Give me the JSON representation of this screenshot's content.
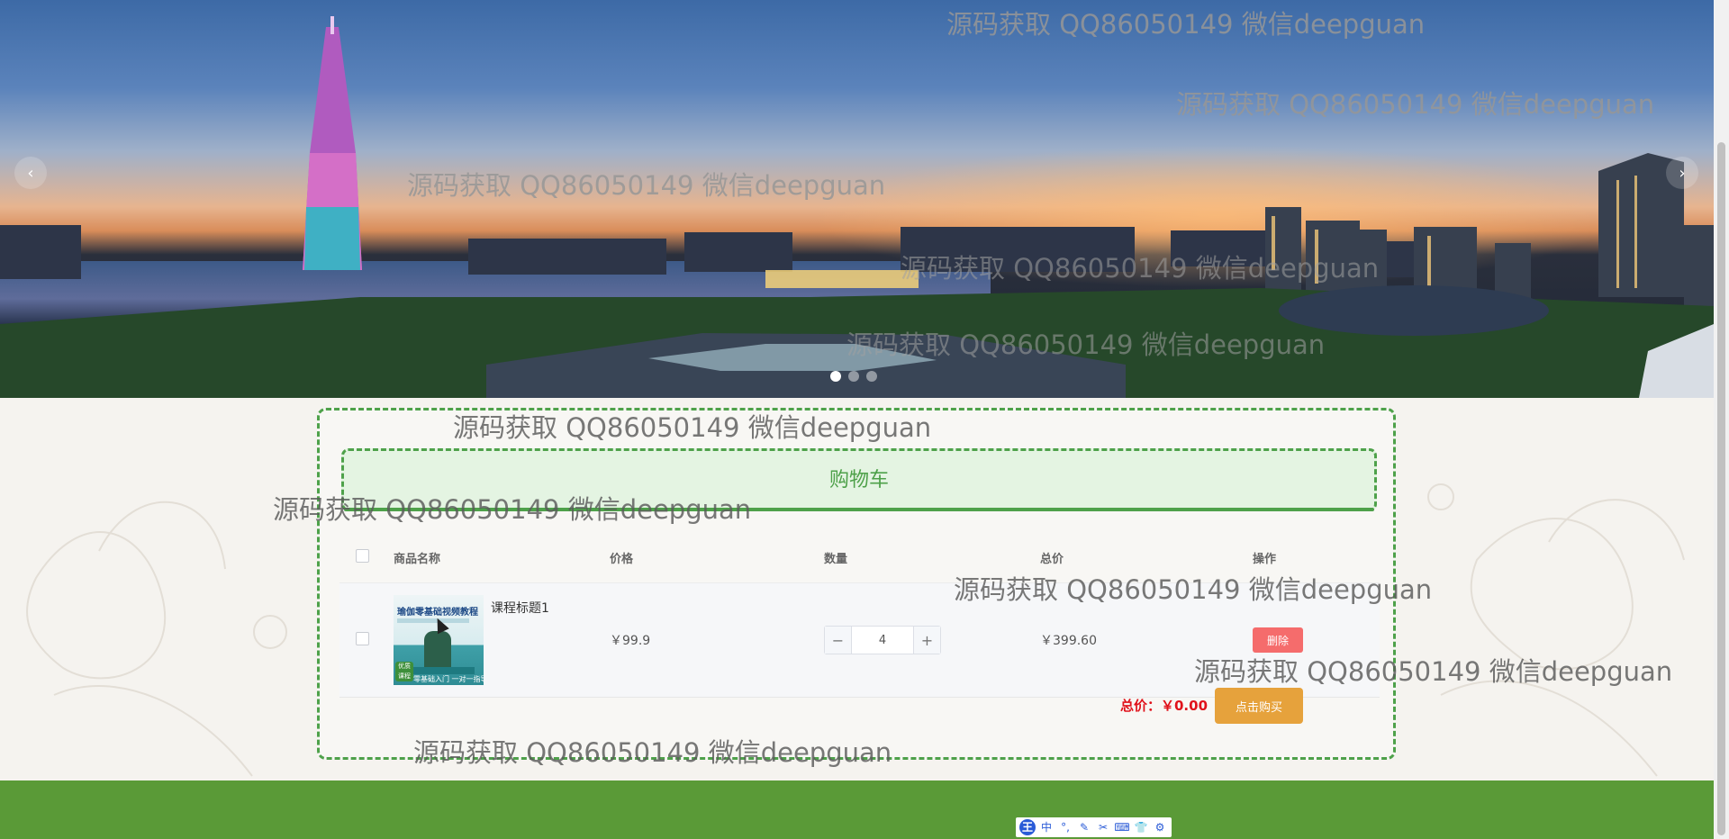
{
  "banner": {
    "prev_icon": "chevron-left-icon",
    "next_icon": "chevron-right-icon",
    "prev_glyph": "‹",
    "next_glyph": "›",
    "slides": 3,
    "active_slide": 1
  },
  "cart": {
    "title": "购物车",
    "columns": [
      "商品名称",
      "价格",
      "数量",
      "总价",
      "操作"
    ],
    "rows": [
      {
        "name": "课程标题1",
        "thumb_title": "瑜伽零基础视频教程",
        "thumb_caption": "零基础入门 一对一指导",
        "thumb_badge": "优质课程",
        "price": "￥99.9",
        "quantity": "4",
        "total": "￥399.60",
        "delete_label": "删除"
      }
    ],
    "stepper_minus": "−",
    "stepper_plus": "+",
    "summary_label": "总价：￥0.00",
    "buy_label": "点击购买"
  },
  "watermark": "源码获取 QQ86050149 微信deepguan",
  "ime_toolbar": [
    "王",
    "中",
    "°,",
    "✎",
    "✂",
    "⌨",
    "👕",
    "⚙"
  ],
  "colors": {
    "accent_green": "#4ea14a",
    "footer_green": "#5a9a37",
    "delete_red": "#f56c6c",
    "buy_orange": "#e6a23c",
    "price_red": "#e0121b"
  }
}
